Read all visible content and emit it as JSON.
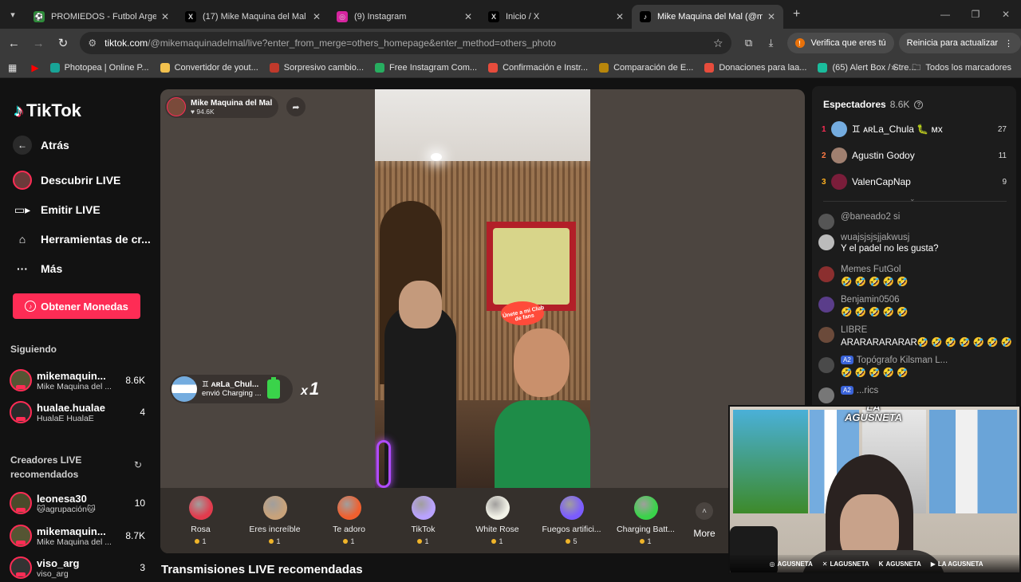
{
  "browser": {
    "tabs": [
      {
        "title": "PROMIEDOS - Futbol Argentino",
        "fav_color": "#2e8b3a",
        "fav_text": "⚽"
      },
      {
        "title": "(17) Mike Maquina del Mal (@m",
        "fav_color": "#000000",
        "fav_text": "X"
      },
      {
        "title": "(9) Instagram",
        "fav_color": "#d6249f",
        "fav_text": "◎"
      },
      {
        "title": "Inicio / X",
        "fav_color": "#000000",
        "fav_text": "X"
      },
      {
        "title": "Mike Maquina del Mal (@m",
        "fav_color": "#000000",
        "fav_text": "♪"
      }
    ],
    "url_host": "tiktok.com",
    "url_path": "/@mikemaquinadelmal/live?enter_from_merge=others_homepage&enter_method=others_photo",
    "verify_label": "Verifica que eres tú",
    "update_label": "Reinicia para actualizar",
    "bookmarks": [
      {
        "label": "Photopea | Online P...",
        "color": "#18a497"
      },
      {
        "label": "Convertidor de yout...",
        "color": "#f2c14e"
      },
      {
        "label": "Sorpresivo cambio...",
        "color": "#c0392b"
      },
      {
        "label": "Free Instagram Com...",
        "color": "#27ae60"
      },
      {
        "label": "Confirmación e Instr...",
        "color": "#e74c3c"
      },
      {
        "label": "Comparación de E...",
        "color": "#b8860b"
      },
      {
        "label": "Donaciones para laa...",
        "color": "#e74c3c"
      },
      {
        "label": "(65) Alert Box / Stre...",
        "color": "#1abc9c"
      }
    ],
    "all_bookmarks": "Todos los marcadores"
  },
  "sidebar": {
    "brand": "TikTok",
    "back": "Atrás",
    "nav": [
      {
        "label": "Descubrir LIVE",
        "icon": "live-avatar-icon"
      },
      {
        "label": "Emitir LIVE",
        "icon": "camera-icon"
      },
      {
        "label": "Herramientas de cr...",
        "icon": "home-tools-icon"
      },
      {
        "label": "Más",
        "icon": "more-dots-icon"
      }
    ],
    "coins_button": "Obtener Monedas",
    "following_title": "Siguiendo",
    "following": [
      {
        "name": "mikemaquin...",
        "sub": "Mike Maquina del ...",
        "count": "8.6K"
      },
      {
        "name": "hualae.hualae",
        "sub": "HualaE HualaE",
        "count": "4"
      }
    ],
    "recommended_title": "Creadores LIVE recomendados",
    "recommended": [
      {
        "name": "leonesa30",
        "sub": "🐱agrupación🐱",
        "count": "10"
      },
      {
        "name": "mikemaquin...",
        "sub": "Mike Maquina del ...",
        "count": "8.7K"
      },
      {
        "name": "viso_arg",
        "sub": "viso_arg",
        "count": "3"
      }
    ]
  },
  "stream": {
    "host_name": "Mike Maquina del Mal",
    "host_likes": "♥ 94.6K",
    "sticker_text": "Únete a mi Club de fans",
    "gift_sender": "♊ ᴀʀLa_Chul...",
    "gift_text": "envió Charging ...",
    "gift_mult_x": "x",
    "gift_mult_n": "1",
    "gifts": [
      {
        "label": "Rosa",
        "price": "1",
        "color": "#e23b4d"
      },
      {
        "label": "Eres increíble",
        "price": "1",
        "color": "#c8a27a"
      },
      {
        "label": "Te adoro",
        "price": "1",
        "color": "#f0602f"
      },
      {
        "label": "TikTok",
        "price": "1",
        "color": "#b9a2ff"
      },
      {
        "label": "White Rose",
        "price": "1",
        "color": "#f1f1e6"
      },
      {
        "label": "Fuegos artifici...",
        "price": "5",
        "color": "#7b5cff"
      },
      {
        "label": "Charging Batt...",
        "price": "1",
        "color": "#3ad34a"
      }
    ],
    "more_label": "More",
    "recommended_header": "Transmisiones LIVE recomendadas"
  },
  "panel": {
    "viewers_title": "Espectadores",
    "viewers_count": "8.6K",
    "top_viewers": [
      {
        "rank": "1",
        "name": "♊ ᴀʀLa_Chula 🐛 ᴍx",
        "score": "27",
        "color": "#74acdf"
      },
      {
        "rank": "2",
        "name": "Agustin Godoy",
        "score": "11",
        "color": "#a08070"
      },
      {
        "rank": "3",
        "name": "ValenCapNap",
        "score": "9",
        "color": "#7a1d3a"
      }
    ],
    "chat": [
      {
        "user": "@baneado2 si",
        "text": "",
        "color": "#555555"
      },
      {
        "user": "wuajsjsjsjjakwusj",
        "text": "Y el padel no les gusta?",
        "color": "#bbbbbb"
      },
      {
        "user": "Memes FutGol",
        "text": "🤣 🤣 🤣 🤣 🤣",
        "color": "#8b2f2f"
      },
      {
        "user": "Benjamin0506",
        "text": "🤣 🤣 🤣 🤣 🤣",
        "color": "#5a3d8a"
      },
      {
        "user": "LIBRE",
        "text": "ARARARARARAR🤣 🤣 🤣 🤣 🤣 🤣 🤣",
        "color": "#6b4a3a"
      },
      {
        "user": "Topógrafo Kilsman L...",
        "text": "🤣 🤣 🤣 🤣 🤣",
        "color": "#4a4a4a",
        "level": "A2"
      },
      {
        "user": "...rics",
        "text": "",
        "color": "#777777",
        "level": "A2"
      }
    ]
  },
  "webcam": {
    "brand_line1": "LA",
    "brand_line2": "AGUSNETA",
    "socials": [
      "AGUSNETA",
      "LAGUSNETA",
      "AGUSNETA",
      "LA AGUSNETA"
    ]
  }
}
